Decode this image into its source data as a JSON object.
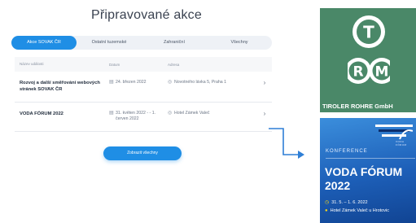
{
  "page": {
    "title": "Připravované akce"
  },
  "tabs": [
    {
      "label": "Akce SOVAK ČR",
      "active": true
    },
    {
      "label": "Ostatní tuzemské",
      "active": false
    },
    {
      "label": "Zahraniční",
      "active": false
    },
    {
      "label": "Všechny",
      "active": false
    }
  ],
  "table": {
    "headers": {
      "name": "Název události",
      "date": "Datum",
      "address": "Adresa"
    },
    "rows": [
      {
        "name": "Rozvoj a další směřování webových stránek SOVAK ČR",
        "date": "24. březen 2022",
        "address": "Novotného lávka 5, Praha 1"
      },
      {
        "name": "VODA FÓRUM 2022",
        "date": "31. květen 2022 - - 1. červen 2022",
        "address": "Hotel Zámek Valeč"
      }
    ]
  },
  "show_all_button": "Zobrazit všechny",
  "ads": {
    "tiroler": {
      "brand": "TIROLER ROHRE GmbH",
      "logo_letters": [
        "T",
        "R",
        "M"
      ],
      "bg": "#4a8868"
    },
    "voda_forum": {
      "small_logo": "VODA FÓRUM",
      "konference": "KONFERENCE",
      "title_line1": "VODA FÓRUM",
      "title_line2": "2022",
      "date": "31. 5. – 1. 6. 2022",
      "place": "Hotel Zámek Valeč u Hrotovic"
    }
  },
  "colors": {
    "accent": "#1f8ee5",
    "arrow": "#2f7fd6",
    "ad_yellow": "#f3d21c"
  }
}
